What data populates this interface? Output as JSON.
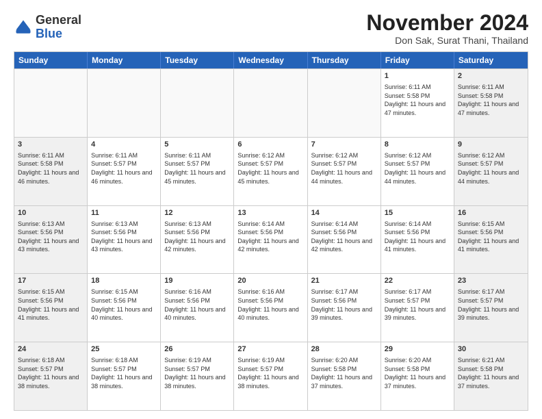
{
  "logo": {
    "general": "General",
    "blue": "Blue"
  },
  "header": {
    "month": "November 2024",
    "location": "Don Sak, Surat Thani, Thailand"
  },
  "days": [
    "Sunday",
    "Monday",
    "Tuesday",
    "Wednesday",
    "Thursday",
    "Friday",
    "Saturday"
  ],
  "rows": [
    [
      {
        "day": "",
        "text": "",
        "empty": true
      },
      {
        "day": "",
        "text": "",
        "empty": true
      },
      {
        "day": "",
        "text": "",
        "empty": true
      },
      {
        "day": "",
        "text": "",
        "empty": true
      },
      {
        "day": "",
        "text": "",
        "empty": true
      },
      {
        "day": "1",
        "text": "Sunrise: 6:11 AM\nSunset: 5:58 PM\nDaylight: 11 hours and 47 minutes."
      },
      {
        "day": "2",
        "text": "Sunrise: 6:11 AM\nSunset: 5:58 PM\nDaylight: 11 hours and 47 minutes.",
        "shaded": true
      }
    ],
    [
      {
        "day": "3",
        "text": "Sunrise: 6:11 AM\nSunset: 5:58 PM\nDaylight: 11 hours and 46 minutes.",
        "shaded": true
      },
      {
        "day": "4",
        "text": "Sunrise: 6:11 AM\nSunset: 5:57 PM\nDaylight: 11 hours and 46 minutes."
      },
      {
        "day": "5",
        "text": "Sunrise: 6:11 AM\nSunset: 5:57 PM\nDaylight: 11 hours and 45 minutes."
      },
      {
        "day": "6",
        "text": "Sunrise: 6:12 AM\nSunset: 5:57 PM\nDaylight: 11 hours and 45 minutes."
      },
      {
        "day": "7",
        "text": "Sunrise: 6:12 AM\nSunset: 5:57 PM\nDaylight: 11 hours and 44 minutes."
      },
      {
        "day": "8",
        "text": "Sunrise: 6:12 AM\nSunset: 5:57 PM\nDaylight: 11 hours and 44 minutes."
      },
      {
        "day": "9",
        "text": "Sunrise: 6:12 AM\nSunset: 5:57 PM\nDaylight: 11 hours and 44 minutes.",
        "shaded": true
      }
    ],
    [
      {
        "day": "10",
        "text": "Sunrise: 6:13 AM\nSunset: 5:56 PM\nDaylight: 11 hours and 43 minutes.",
        "shaded": true
      },
      {
        "day": "11",
        "text": "Sunrise: 6:13 AM\nSunset: 5:56 PM\nDaylight: 11 hours and 43 minutes."
      },
      {
        "day": "12",
        "text": "Sunrise: 6:13 AM\nSunset: 5:56 PM\nDaylight: 11 hours and 42 minutes."
      },
      {
        "day": "13",
        "text": "Sunrise: 6:14 AM\nSunset: 5:56 PM\nDaylight: 11 hours and 42 minutes."
      },
      {
        "day": "14",
        "text": "Sunrise: 6:14 AM\nSunset: 5:56 PM\nDaylight: 11 hours and 42 minutes."
      },
      {
        "day": "15",
        "text": "Sunrise: 6:14 AM\nSunset: 5:56 PM\nDaylight: 11 hours and 41 minutes."
      },
      {
        "day": "16",
        "text": "Sunrise: 6:15 AM\nSunset: 5:56 PM\nDaylight: 11 hours and 41 minutes.",
        "shaded": true
      }
    ],
    [
      {
        "day": "17",
        "text": "Sunrise: 6:15 AM\nSunset: 5:56 PM\nDaylight: 11 hours and 41 minutes.",
        "shaded": true
      },
      {
        "day": "18",
        "text": "Sunrise: 6:15 AM\nSunset: 5:56 PM\nDaylight: 11 hours and 40 minutes."
      },
      {
        "day": "19",
        "text": "Sunrise: 6:16 AM\nSunset: 5:56 PM\nDaylight: 11 hours and 40 minutes."
      },
      {
        "day": "20",
        "text": "Sunrise: 6:16 AM\nSunset: 5:56 PM\nDaylight: 11 hours and 40 minutes."
      },
      {
        "day": "21",
        "text": "Sunrise: 6:17 AM\nSunset: 5:56 PM\nDaylight: 11 hours and 39 minutes."
      },
      {
        "day": "22",
        "text": "Sunrise: 6:17 AM\nSunset: 5:57 PM\nDaylight: 11 hours and 39 minutes."
      },
      {
        "day": "23",
        "text": "Sunrise: 6:17 AM\nSunset: 5:57 PM\nDaylight: 11 hours and 39 minutes.",
        "shaded": true
      }
    ],
    [
      {
        "day": "24",
        "text": "Sunrise: 6:18 AM\nSunset: 5:57 PM\nDaylight: 11 hours and 38 minutes.",
        "shaded": true
      },
      {
        "day": "25",
        "text": "Sunrise: 6:18 AM\nSunset: 5:57 PM\nDaylight: 11 hours and 38 minutes."
      },
      {
        "day": "26",
        "text": "Sunrise: 6:19 AM\nSunset: 5:57 PM\nDaylight: 11 hours and 38 minutes."
      },
      {
        "day": "27",
        "text": "Sunrise: 6:19 AM\nSunset: 5:57 PM\nDaylight: 11 hours and 38 minutes."
      },
      {
        "day": "28",
        "text": "Sunrise: 6:20 AM\nSunset: 5:58 PM\nDaylight: 11 hours and 37 minutes."
      },
      {
        "day": "29",
        "text": "Sunrise: 6:20 AM\nSunset: 5:58 PM\nDaylight: 11 hours and 37 minutes."
      },
      {
        "day": "30",
        "text": "Sunrise: 6:21 AM\nSunset: 5:58 PM\nDaylight: 11 hours and 37 minutes.",
        "shaded": true
      }
    ]
  ]
}
